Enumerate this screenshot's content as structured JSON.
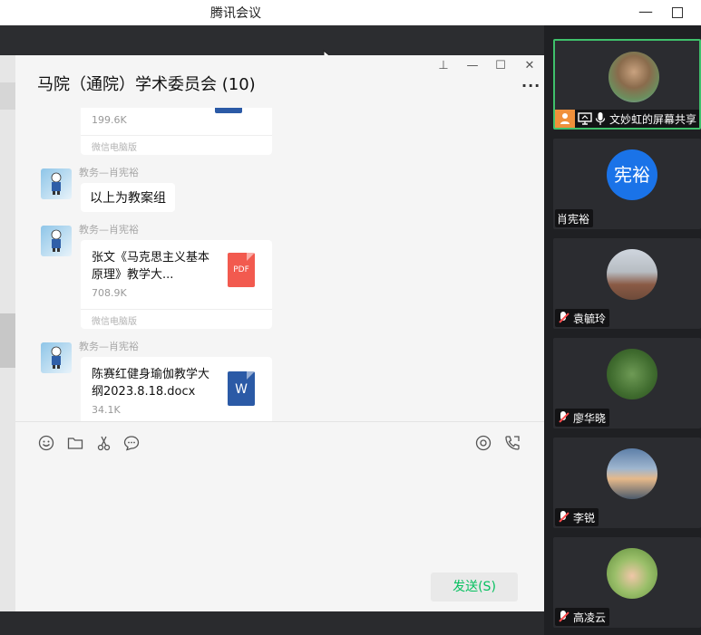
{
  "app": {
    "title": "腾讯会议",
    "minimize": "—"
  },
  "chat": {
    "title": "马院（通院）学术委员会 (10)",
    "controls": {
      "pin": "⊥",
      "minimize": "—",
      "maximize": "☐",
      "close": "✕"
    },
    "more": "···",
    "messages": [
      {
        "type": "file-partial",
        "size": "199.6K",
        "source": "微信电脑版"
      },
      {
        "type": "text",
        "sender": "教务—肖宪裕",
        "text": "以上为教案组"
      },
      {
        "type": "file",
        "sender": "教务—肖宪裕",
        "name": "张文《马克思主义基本原理》教学大...",
        "size": "708.9K",
        "source": "微信电脑版",
        "icon": "pdf-icon",
        "icon_label": "PDF",
        "icon_color": "#f25a4f"
      },
      {
        "type": "file",
        "sender": "教务—肖宪裕",
        "name": "陈赛红健身瑜伽教学大纲2023.8.18.docx",
        "size": "34.1K",
        "icon": "word-icon",
        "icon_label": "W",
        "icon_color": "#2b5aa6"
      }
    ],
    "send_label": "发送(S)"
  },
  "participants": [
    {
      "name": "文妙虹的屏幕共享",
      "role": "sharing"
    },
    {
      "name": "肖宪裕",
      "initials": "宪裕"
    },
    {
      "name": "袁毓玲"
    },
    {
      "name": "廖华晓"
    },
    {
      "name": "李锐"
    },
    {
      "name": "高凌云"
    }
  ],
  "colors": {
    "send_text": "#07c160",
    "active_tile_border": "#3fc06b",
    "initials_bg": "#1a73e8"
  }
}
